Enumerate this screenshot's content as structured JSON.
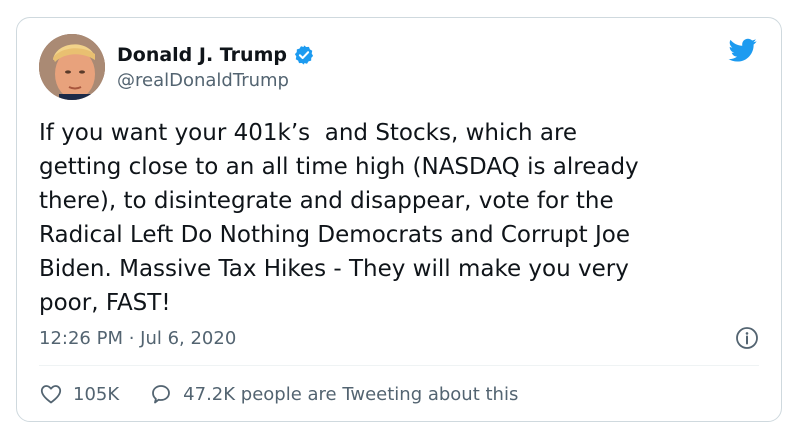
{
  "tweet": {
    "author_name": "Donald J. Trump",
    "author_handle": "@realDonaldTrump",
    "verified": true,
    "text": "If you want your 401k’s  and Stocks, which are\ngetting close to an all time high (NASDAQ is already\nthere), to disintegrate and disappear, vote for the\nRadical Left Do Nothing Democrats and Corrupt Joe\nBiden. Massive Tax Hikes - They will make you very\npoor, FAST!",
    "timestamp": "12:26 PM · Jul 6, 2020",
    "likes": "105K",
    "engagement_text": "47.2K people are Tweeting about this"
  },
  "icons": {
    "brand": "twitter-bird-icon",
    "verified": "verified-badge-icon",
    "info": "info-icon",
    "like": "heart-icon",
    "reply": "speech-bubble-icon"
  },
  "colors": {
    "brand_blue": "#1d9bf0",
    "text_primary": "#0f1419",
    "text_secondary": "#536471",
    "border": "#cfd9de"
  }
}
